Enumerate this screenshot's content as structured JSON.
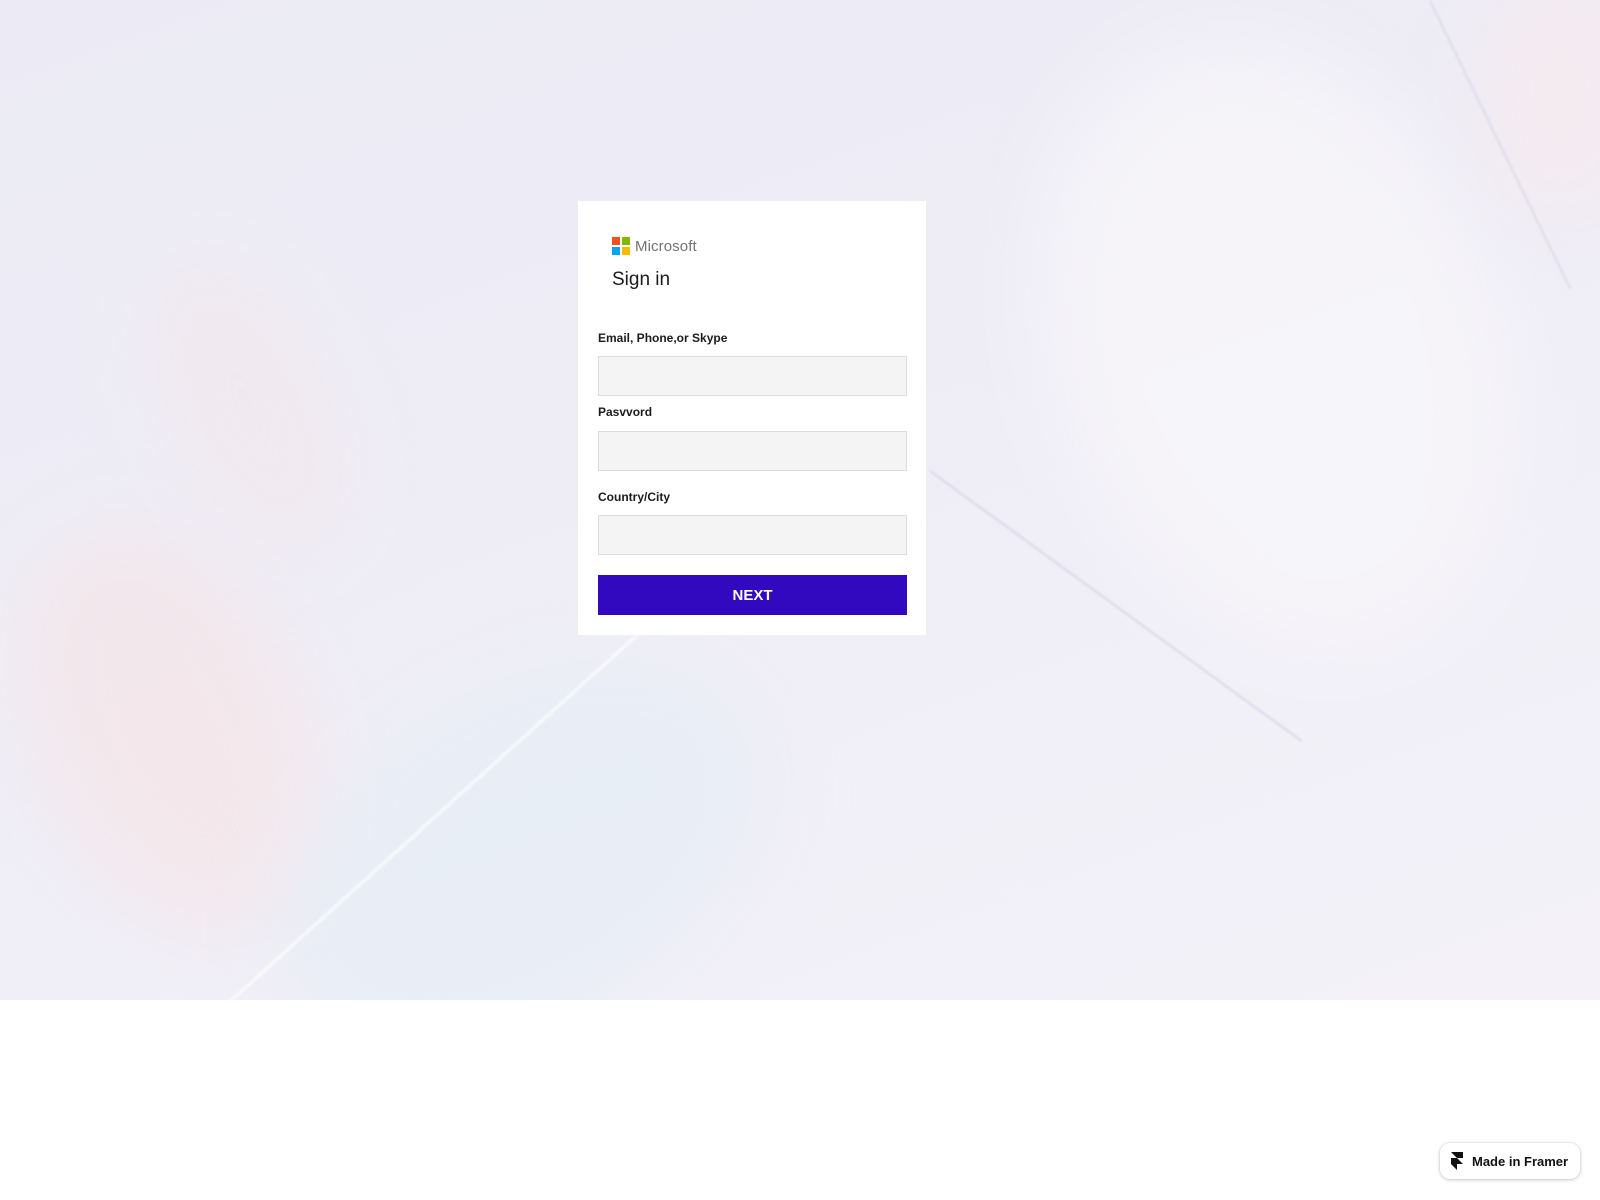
{
  "brand": {
    "name": "Microsoft",
    "logo_colors": [
      "#f25022",
      "#7fba00",
      "#00a4ef",
      "#ffb900"
    ]
  },
  "signin": {
    "title": "Sign in",
    "fields": [
      {
        "label": "Email, Phone,or Skype",
        "value": "",
        "placeholder": ""
      },
      {
        "label": "Pasvvord",
        "value": "",
        "placeholder": ""
      },
      {
        "label": "Country/City",
        "value": "",
        "placeholder": ""
      }
    ],
    "next_label": "NEXT",
    "accent_color": "#3209bf"
  },
  "badge": {
    "label": "Made in Framer",
    "icon": "framer-logo-icon"
  }
}
